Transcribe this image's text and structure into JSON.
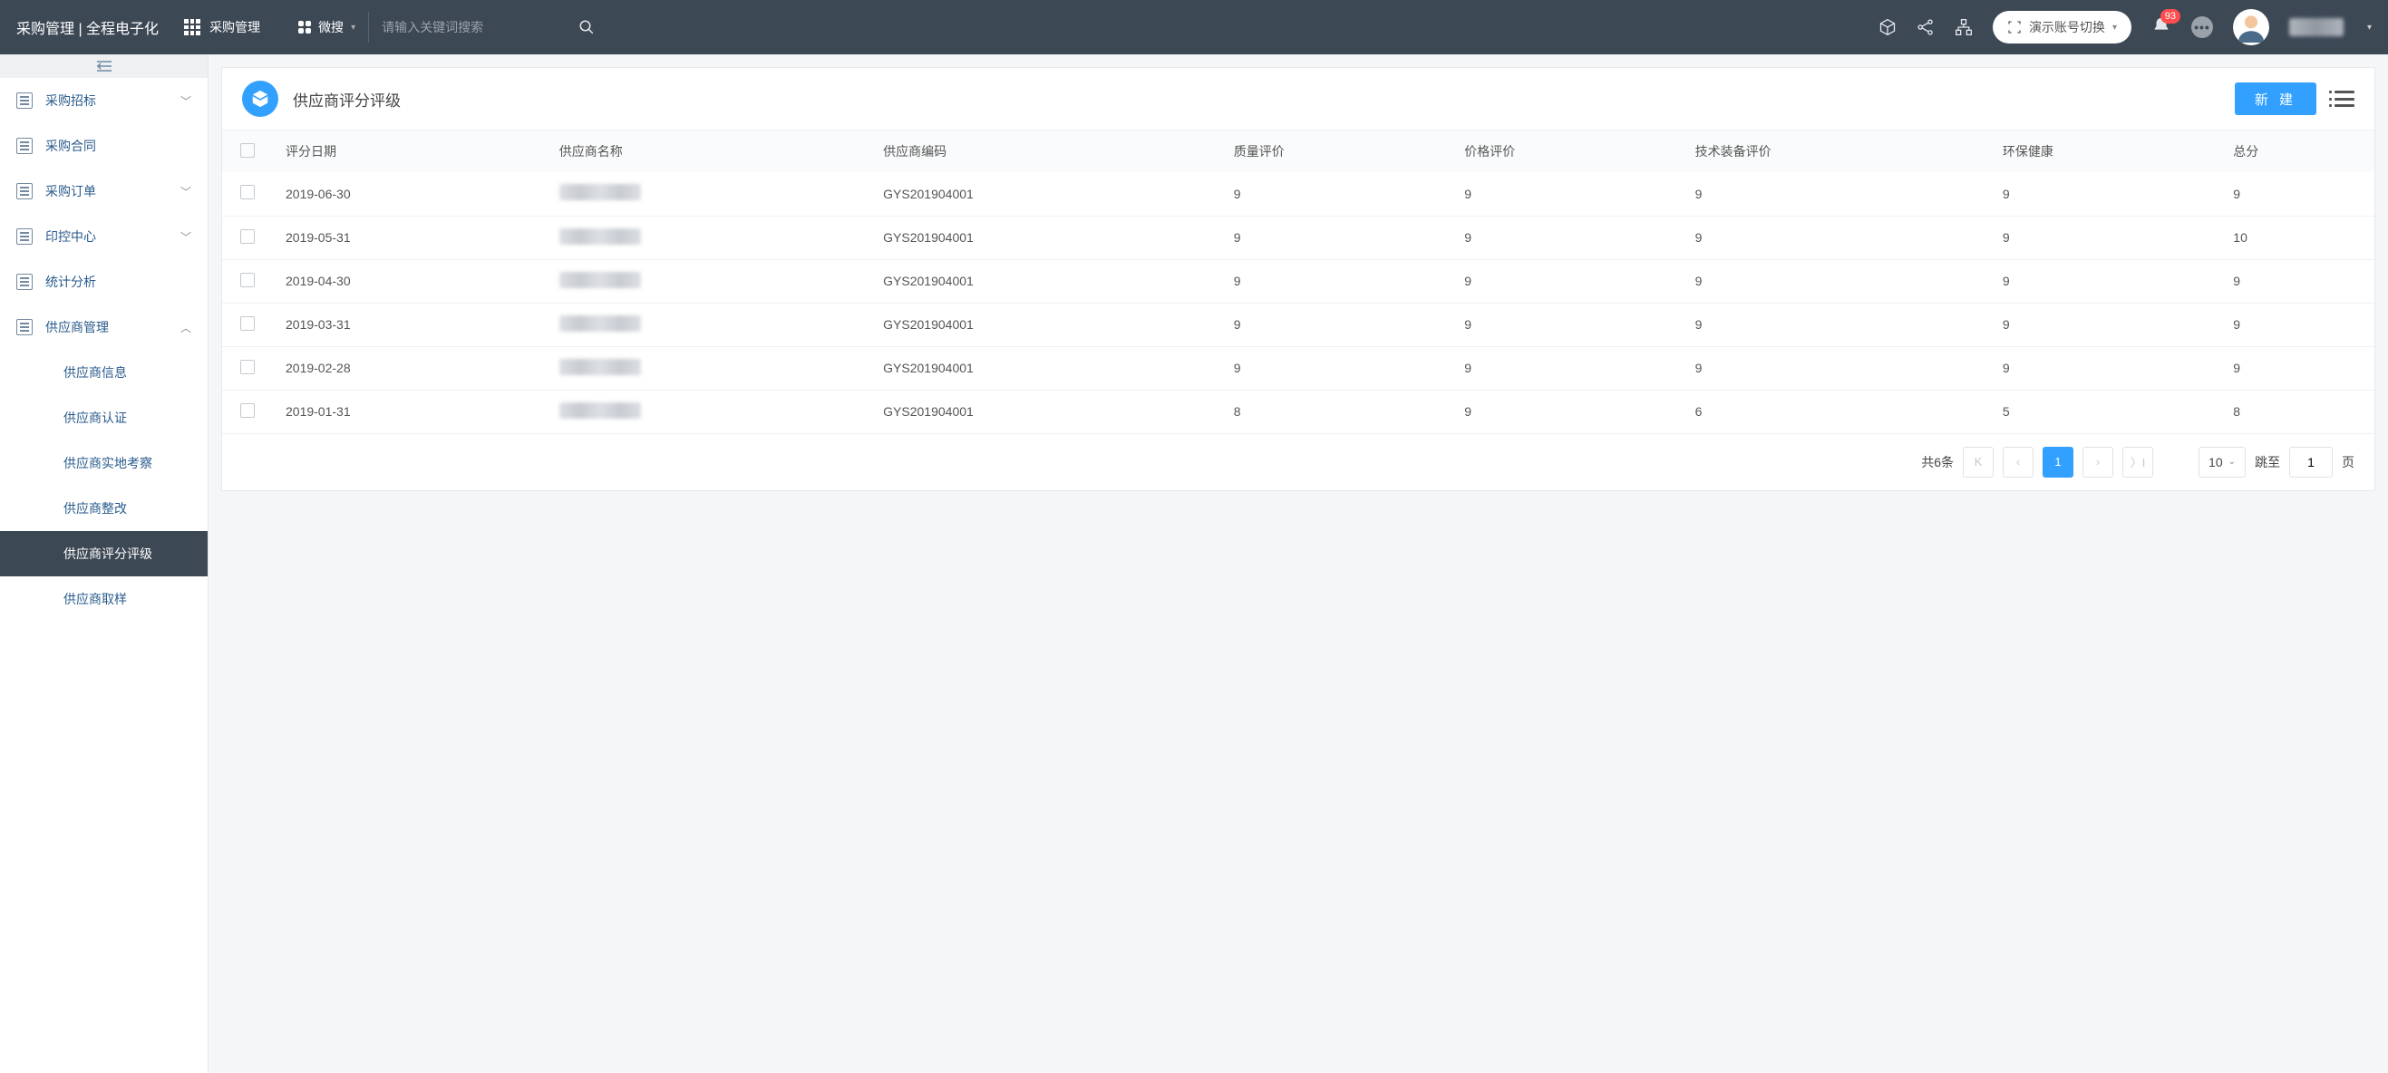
{
  "header": {
    "app_title": "采购管理 | 全程电子化",
    "module_label": "采购管理",
    "search_type_label": "微搜",
    "search_placeholder": "请输入关键词搜索",
    "account_switch_label": "演示账号切换",
    "notif_count": "93"
  },
  "sidebar": {
    "items": [
      {
        "label": "采购招标",
        "expandable": true
      },
      {
        "label": "采购合同",
        "expandable": false
      },
      {
        "label": "采购订单",
        "expandable": true
      },
      {
        "label": "印控中心",
        "expandable": true
      },
      {
        "label": "统计分析",
        "expandable": false
      },
      {
        "label": "供应商管理",
        "expandable": true,
        "expanded": true
      }
    ],
    "sub_items": [
      {
        "label": "供应商信息"
      },
      {
        "label": "供应商认证"
      },
      {
        "label": "供应商实地考察"
      },
      {
        "label": "供应商整改"
      },
      {
        "label": "供应商评分评级",
        "active": true
      },
      {
        "label": "供应商取样"
      }
    ]
  },
  "page": {
    "title": "供应商评分评级",
    "new_btn": "新 建",
    "columns": [
      "评分日期",
      "供应商名称",
      "供应商编码",
      "质量评价",
      "价格评价",
      "技术装备评价",
      "环保健康",
      "总分"
    ],
    "rows": [
      {
        "date": "2019-06-30",
        "code": "GYS201904001",
        "quality": "9",
        "price": "9",
        "tech": "9",
        "env": "9",
        "total": "9"
      },
      {
        "date": "2019-05-31",
        "code": "GYS201904001",
        "quality": "9",
        "price": "9",
        "tech": "9",
        "env": "9",
        "total": "10"
      },
      {
        "date": "2019-04-30",
        "code": "GYS201904001",
        "quality": "9",
        "price": "9",
        "tech": "9",
        "env": "9",
        "total": "9"
      },
      {
        "date": "2019-03-31",
        "code": "GYS201904001",
        "quality": "9",
        "price": "9",
        "tech": "9",
        "env": "9",
        "total": "9"
      },
      {
        "date": "2019-02-28",
        "code": "GYS201904001",
        "quality": "9",
        "price": "9",
        "tech": "9",
        "env": "9",
        "total": "9"
      },
      {
        "date": "2019-01-31",
        "code": "GYS201904001",
        "quality": "8",
        "price": "9",
        "tech": "6",
        "env": "5",
        "total": "8"
      }
    ]
  },
  "pager": {
    "total_text": "共6条",
    "current": "1",
    "size": "10",
    "jump_label": "跳至",
    "jump_value": "1",
    "jump_suffix": "页"
  }
}
